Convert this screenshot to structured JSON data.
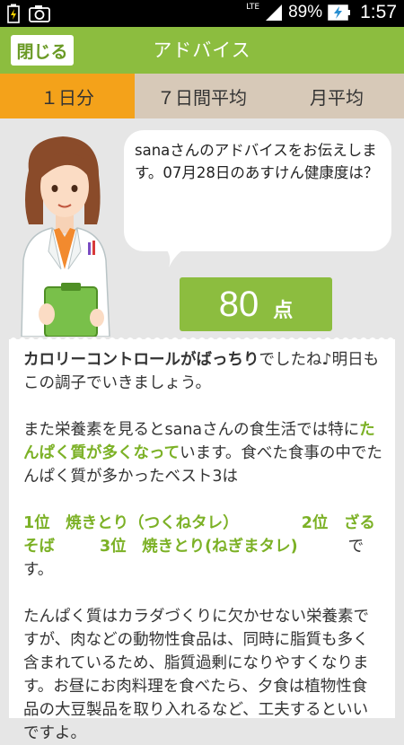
{
  "status_bar": {
    "lte": "LTE",
    "battery_percent": "89%",
    "time": "1:57"
  },
  "header": {
    "close_label": "閉じる",
    "title": "アドバイス"
  },
  "tabs": [
    {
      "label": "１日分",
      "active": true
    },
    {
      "label": "７日間平均",
      "active": false
    },
    {
      "label": "月平均",
      "active": false
    }
  ],
  "speech_bubble": {
    "text": "sanaさんのアドバイスをお伝えします。07月28日のあすけん健康度は？"
  },
  "score": {
    "value": "80",
    "unit": "点"
  },
  "advice": {
    "p1_highlight": "カロリーコントロールがばっちり",
    "p1_rest": "でしたね♪明日もこの調子でいきましょう。",
    "p2_pre": "また栄養素を見るとsanaさんの食生活では特に",
    "p2_highlight": "たんぱく質が多くなって",
    "p2_post": "います。食べた食事の中でたんぱく質が多かったベスト3は",
    "rank1": "1位　焼きとり（つくねタレ）",
    "rank2": "2位　ざるそば",
    "rank3": "3位　焼きとり(ねぎまタレ)",
    "rank_suffix": "です。",
    "p4": "たんぱく質はカラダづくりに欠かせない栄養素ですが、肉などの動物性食品は、同時に脂質も多く含まれているため、脂質過剰になりやすくなります。お昼にお肉料理を食べたら、夕食は植物性食品の大豆製品を取り入れるなど、工夫するといいですよ。"
  },
  "colors": {
    "green": "#8cbd3f",
    "tab_active": "#f4a21a",
    "tab_inactive": "#d7c9b8",
    "highlight_text": "#7cb126"
  }
}
